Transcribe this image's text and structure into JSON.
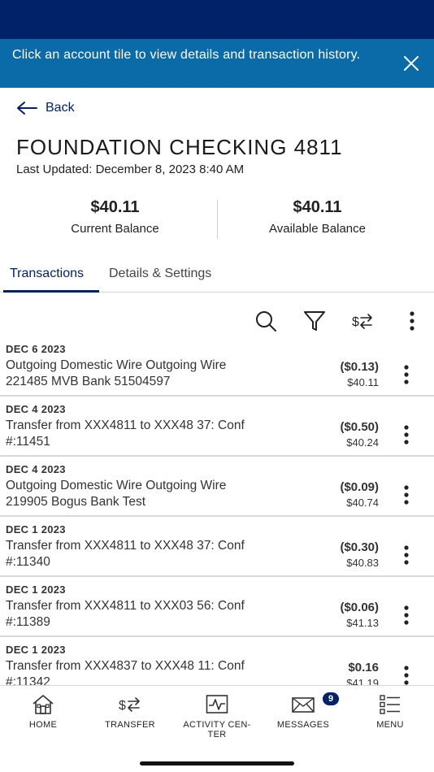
{
  "banner": {
    "message": "Click an account tile to view details and transaction history."
  },
  "nav": {
    "back_label": "Back"
  },
  "account": {
    "title": "FOUNDATION CHECKING 4811",
    "last_updated": "Last Updated: December 8, 2023 8:40 AM"
  },
  "balances": {
    "current": {
      "amount": "$40.11",
      "label": "Current Balance"
    },
    "available": {
      "amount": "$40.11",
      "label": "Available Balance"
    }
  },
  "tabs": [
    {
      "label": "Transactions",
      "active": true
    },
    {
      "label": "Details & Settings",
      "active": false
    }
  ],
  "toolbar": {
    "icons": [
      "search-icon",
      "filter-icon",
      "transfer-icon",
      "more-vertical-icon"
    ]
  },
  "transactions": [
    {
      "date": "DEC 6 2023",
      "description": "Outgoing Domestic Wire Outgoing Wire 221485 MVB Bank 51504597",
      "amount": "($0.13)",
      "balance": "$40.11"
    },
    {
      "date": "DEC 4 2023",
      "description": "Transfer from XXX4811 to XXX48 37: Conf #:11451",
      "amount": "($0.50)",
      "balance": "$40.24"
    },
    {
      "date": "DEC 4 2023",
      "description": "Outgoing Domestic Wire Outgoing Wire 219905 Bogus Bank Test",
      "amount": "($0.09)",
      "balance": "$40.74"
    },
    {
      "date": "DEC 1 2023",
      "description": "Transfer from XXX4811 to XXX48 37: Conf #:11340",
      "amount": "($0.30)",
      "balance": "$40.83"
    },
    {
      "date": "DEC 1 2023",
      "description": "Transfer from XXX4811 to XXX03 56: Conf #:11389",
      "amount": "($0.06)",
      "balance": "$41.13"
    },
    {
      "date": "DEC 1 2023",
      "description": "Transfer from XXX4837 to XXX48 11: Conf #:11342",
      "amount": "$0.16",
      "balance": "$41.19"
    }
  ],
  "bottom_nav": {
    "home": "HOME",
    "transfer": "TRANSFER",
    "activity": "ACTIVITY CEN-TER",
    "messages": "MESSAGES",
    "messages_badge": "9",
    "menu": "MENU"
  },
  "colors": {
    "brand_navy": "#012169",
    "banner_blue": "#0b6aa8"
  }
}
